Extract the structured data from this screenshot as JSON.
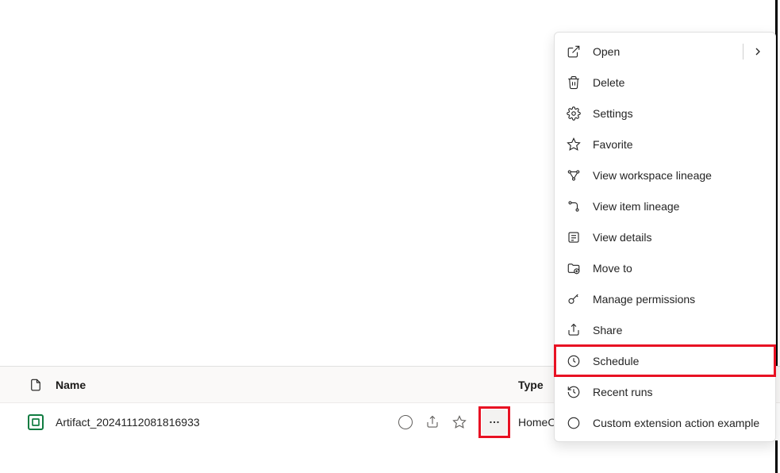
{
  "table": {
    "headers": {
      "name": "Name",
      "type": "Type"
    },
    "rows": [
      {
        "name": "Artifact_20241112081816933",
        "type": "HomeOne",
        "last": "—"
      }
    ]
  },
  "contextMenu": {
    "items": [
      {
        "label": "Open",
        "hasSubmenu": true
      },
      {
        "label": "Delete"
      },
      {
        "label": "Settings"
      },
      {
        "label": "Favorite"
      },
      {
        "label": "View workspace lineage"
      },
      {
        "label": "View item lineage"
      },
      {
        "label": "View details"
      },
      {
        "label": "Move to"
      },
      {
        "label": "Manage permissions"
      },
      {
        "label": "Share"
      },
      {
        "label": "Schedule",
        "highlighted": true
      },
      {
        "label": "Recent runs"
      },
      {
        "label": "Custom extension action example"
      }
    ]
  }
}
